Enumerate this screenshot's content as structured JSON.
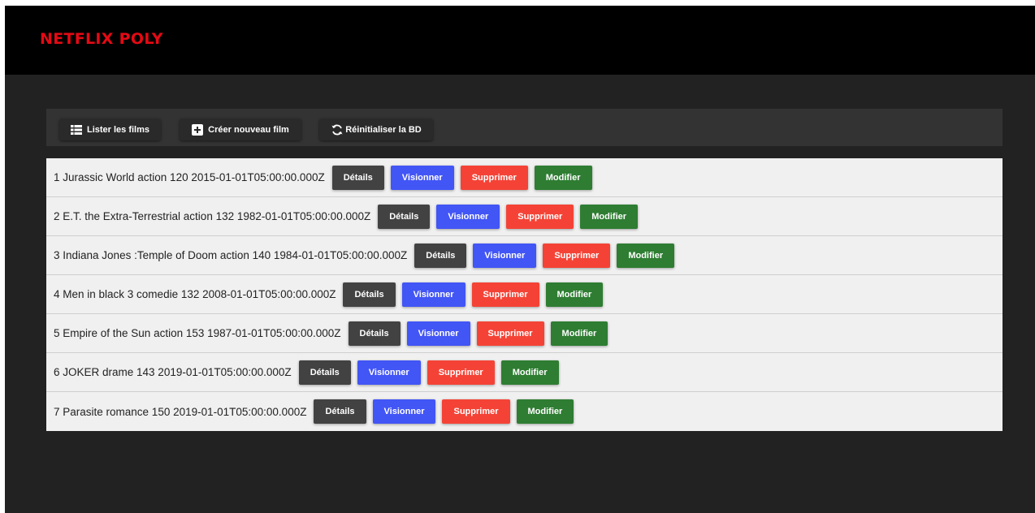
{
  "header": {
    "brand": "NETFLIX POLY"
  },
  "toolbar": {
    "list_label": "Lister les films",
    "create_label": "Créer nouveau film",
    "reset_label": "Réinitialiser la BD"
  },
  "actions": {
    "details": "Détails",
    "watch": "Visionner",
    "delete": "Supprimer",
    "edit": "Modifier"
  },
  "films": [
    {
      "text": "1 Jurassic World action 120 2015-01-01T05:00:00.000Z"
    },
    {
      "text": "2 E.T. the Extra-Terrestrial action 132 1982-01-01T05:00:00.000Z"
    },
    {
      "text": "3 Indiana Jones :Temple of Doom action 140 1984-01-01T05:00:00.000Z"
    },
    {
      "text": "4 Men in black 3 comedie 132 2008-01-01T05:00:00.000Z"
    },
    {
      "text": "5 Empire of the Sun action 153 1987-01-01T05:00:00.000Z"
    },
    {
      "text": "6 JOKER drame 143 2019-01-01T05:00:00.000Z"
    },
    {
      "text": "7 Parasite romance 150 2019-01-01T05:00:00.000Z"
    }
  ],
  "colors": {
    "brand": "#e50914",
    "details": "#424242",
    "watch": "#4255f5",
    "delete": "#f44336",
    "edit": "#2e7d32"
  },
  "icons": {
    "list": "list-icon",
    "create": "plus-square-icon",
    "reset": "refresh-icon"
  }
}
